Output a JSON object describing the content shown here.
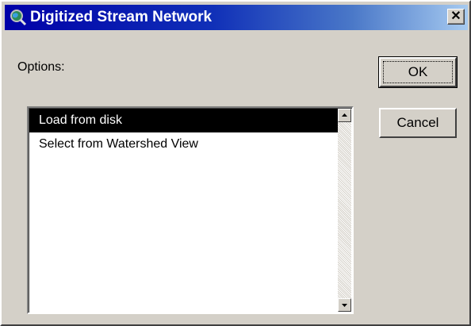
{
  "window": {
    "title": "Digitized Stream Network",
    "close_glyph": "✕",
    "icon": "magnifier-globe-icon"
  },
  "options_label": "Options:",
  "list": {
    "items": [
      {
        "label": "Load from disk",
        "selected": true
      },
      {
        "label": "Select from Watershed View",
        "selected": false
      }
    ]
  },
  "buttons": {
    "ok": "OK",
    "cancel": "Cancel"
  },
  "colors": {
    "face": "#d4d0c8",
    "title_start": "#0000a8",
    "title_end": "#a6caf0",
    "selection": "#000000"
  }
}
